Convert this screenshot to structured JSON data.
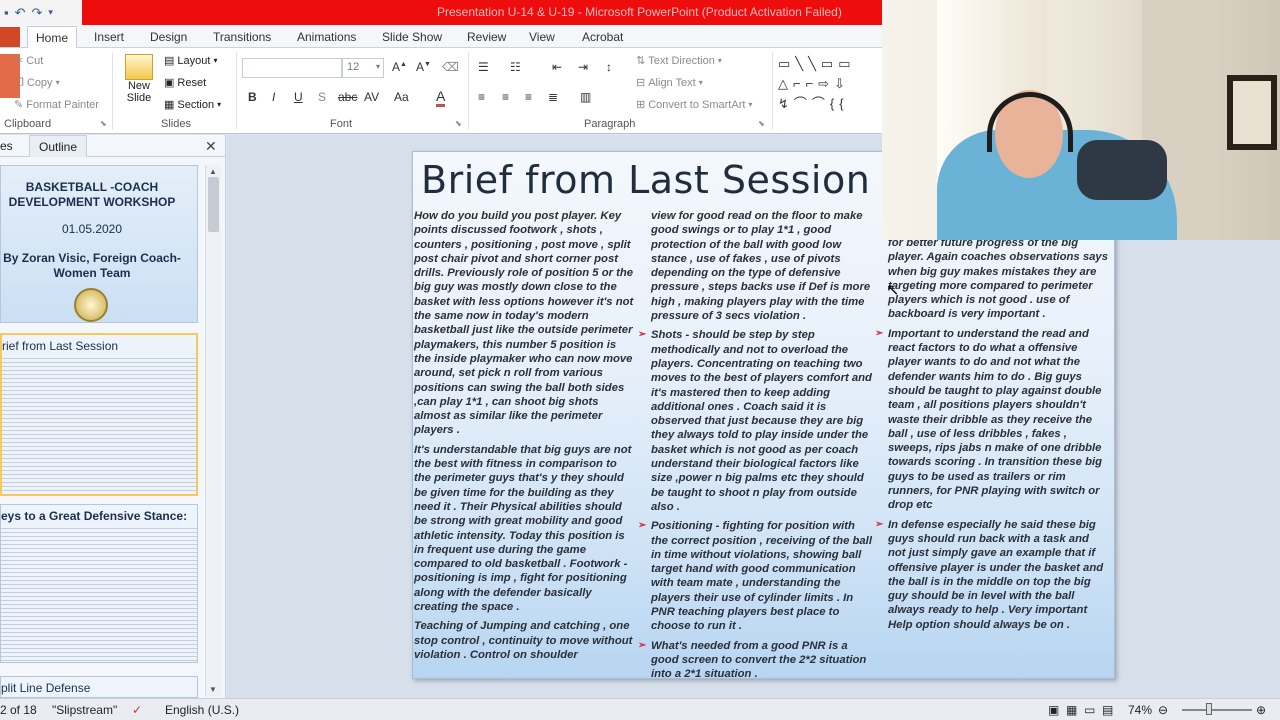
{
  "window": {
    "title": "Presentation U-14 & U-19  -  Microsoft PowerPoint (Product Activation Failed)"
  },
  "ribbon_tabs": [
    "Home",
    "Insert",
    "Design",
    "Transitions",
    "Animations",
    "Slide Show",
    "Review",
    "View",
    "Acrobat"
  ],
  "clipboard": {
    "cut": "Cut",
    "copy": "Copy",
    "format_painter": "Format Painter",
    "label": "Clipboard"
  },
  "slides_group": {
    "new_slide_1": "New",
    "new_slide_2": "Slide",
    "layout": "Layout",
    "reset": "Reset",
    "section": "Section",
    "label": "Slides"
  },
  "font_group": {
    "size": "12",
    "label": "Font",
    "bold": "B",
    "italic": "I",
    "underline": "U",
    "strike": "S",
    "abc": "abc",
    "spacing": "AV",
    "case": "Aa",
    "color": "A"
  },
  "paragraph_group": {
    "text_direction": "Text Direction",
    "align_text": "Align Text",
    "smartart": "Convert to SmartArt",
    "label": "Paragraph"
  },
  "left_pane": {
    "tab_slides": "es",
    "tab_outline": "Outline",
    "thumb1": {
      "line1": "BASKETBALL -COACH",
      "line2": "DEVELOPMENT WORKSHOP",
      "date": "01.05.2020",
      "author1": "By Zoran Visic, Foreign Coach-",
      "author2": "Women Team"
    },
    "thumb2_title": "rief from Last Session",
    "thumb3_title": "eys to a Great Defensive Stance:",
    "thumb4_title": "plit Line Defense"
  },
  "slide": {
    "title": "Brief from Last Session",
    "col1": [
      "How do you build you post player. Key points discussed footwork , shots , counters , positioning , post move , split post chair pivot and short corner post drills. Previously role of position 5 or the big guy was mostly down close to the basket with less options however it's not the same now in today's modern basketball just like the outside perimeter playmakers, this number 5 position is the inside playmaker who can now move around,  set pick n roll from various positions  can swing the ball both sides ,can play 1*1 , can  shoot big shots almost as similar like the perimeter players .",
      "It's understandable that big guys are not the best with fitness in comparison to the perimeter guys that's y they should be given time for the building as they need it . Their  Physical abilities should be strong with great mobility and good athletic intensity. Today this position is in frequent use during the game compared to old basketball . Footwork - positioning is imp , fight for positioning along with the defender basically creating the space .",
      "Teaching of Jumping and catching , one stop control , continuity to move without violation . Control on shoulder"
    ],
    "col2_lead": "view for good read on the floor to make good swings or to play 1*1 , good protection of the ball with good low stance , use of fakes , use of pivots depending on the type of defensive pressure , steps backs use if Def is more high , making players play with the time pressure of 3 secs violation .",
    "col2": [
      "Shots - should be step by step methodically and not to overload the players. Concentrating on teaching two moves to the best of players comfort and it's mastered then to keep adding additional ones . Coach said it is observed that just because they are big they always told to play inside under the basket which is not good as per coach  understand their biological factors like size ,power n big palms etc they should be  taught to shoot n play from outside also .",
      "Positioning - fighting for position with the correct position , receiving of the ball in time without violations, showing ball target hand with good communication with team mate , understanding the players their use of cylinder limits . In PNR teaching players best place to choose to run it .",
      "What's needed from a good PNR  is a good screen to convert the 2*2 situation into a 2*1 situation ."
    ],
    "col3_lead": "for better future progress of the big player. Again coaches observations says when big guy makes mistakes they are targeting more compared to perimeter players which is not good . use of backboard is very important .",
    "col3": [
      "Important to understand the read and react factors to do what a offensive player wants to do and  not what the defender wants him to do . Big guys should be taught to play against double team , all positions players shouldn't waste their dribble as they receive the ball , use of less dribbles , fakes , sweeps, rips jabs n make of one dribble towards scoring . In transition these big guys to be used as trailers or rim runners, for PNR playing with switch or drop etc",
      "In defense especially he said these big guys should run back with a task and not just simply gave an example that if offensive player is under the basket and the ball is in the middle on top the big guy should be in level with the ball always ready to help . Very important Help option should always be on ."
    ]
  },
  "statusbar": {
    "slide_count": "2 of 18",
    "theme": "\"Slipstream\"",
    "language": "English (U.S.)",
    "zoom": "74%"
  }
}
